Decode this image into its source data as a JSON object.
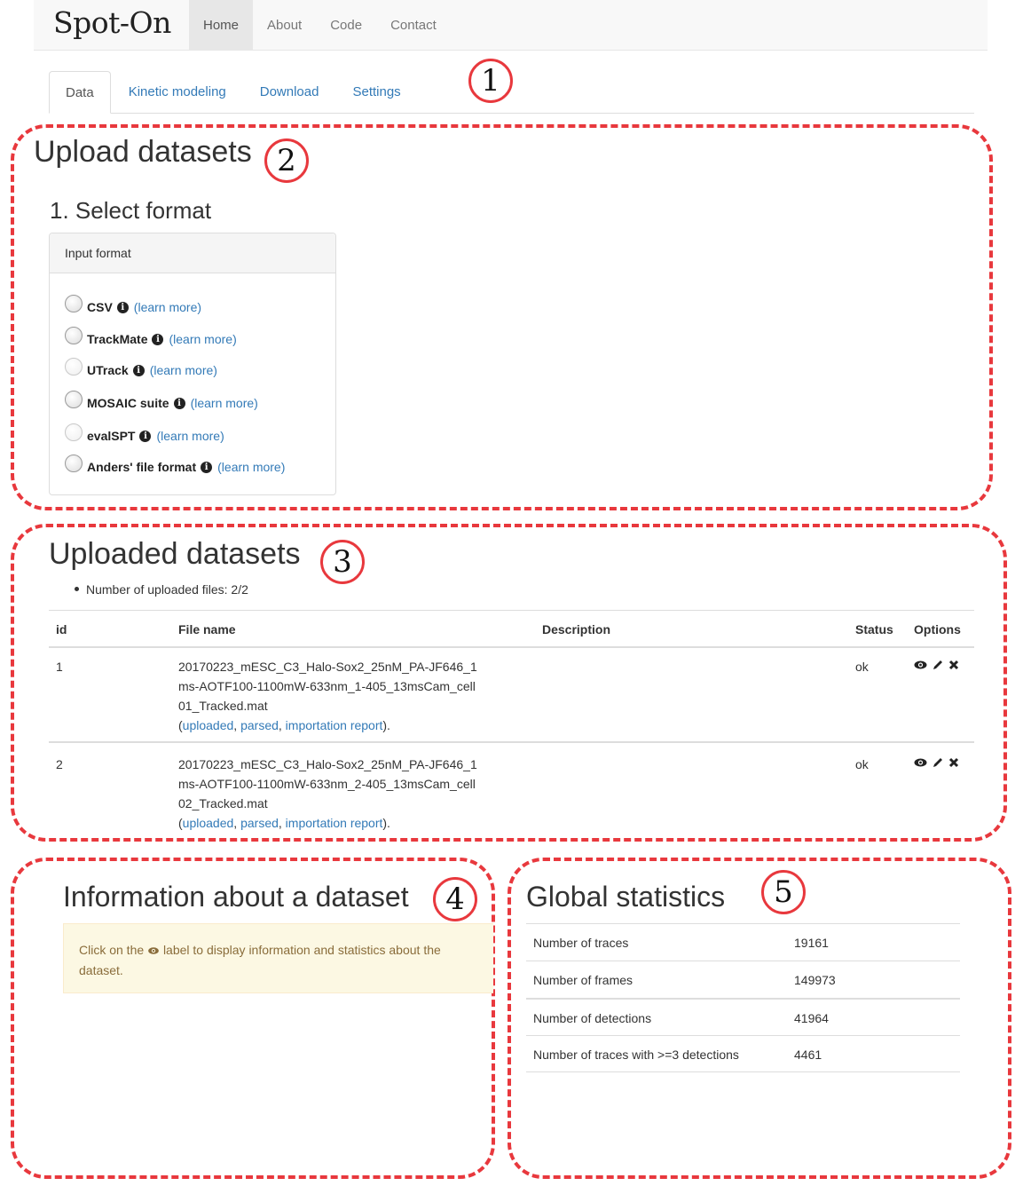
{
  "navbar": {
    "brand": "Spot-On",
    "items": [
      {
        "label": "Home",
        "active": true
      },
      {
        "label": "About",
        "active": false
      },
      {
        "label": "Code",
        "active": false
      },
      {
        "label": "Contact",
        "active": false
      }
    ]
  },
  "tabs": [
    {
      "label": "Data",
      "active": true
    },
    {
      "label": "Kinetic modeling",
      "active": false
    },
    {
      "label": "Download",
      "active": false
    },
    {
      "label": "Settings",
      "active": false
    }
  ],
  "badges": [
    "1",
    "2",
    "3",
    "4",
    "5"
  ],
  "upload": {
    "title": "Upload datasets",
    "step_title": "1. Select format",
    "panel_heading": "Input format",
    "learn_more": "(learn more)",
    "formats": [
      {
        "label": "CSV"
      },
      {
        "label": "TrackMate"
      },
      {
        "label": "UTrack"
      },
      {
        "label": "MOSAIC suite"
      },
      {
        "label": "evalSPT"
      },
      {
        "label": "Anders' file format"
      }
    ]
  },
  "uploaded": {
    "title": "Uploaded datasets",
    "count_text": "Number of uploaded files: 2/2",
    "columns": {
      "id": "id",
      "file_name": "File name",
      "description": "Description",
      "status": "Status",
      "options": "Options"
    },
    "rows": [
      {
        "id": "1",
        "file_name": "20170223_mESC_C3_Halo-Sox2_25nM_PA-JF646_1ms-AOTF100-1100mW-633nm_1-405_13msCam_cell01_Tracked.mat",
        "links": {
          "uploaded": "uploaded",
          "parsed": "parsed",
          "report": "importation report"
        },
        "description": "",
        "status": "ok"
      },
      {
        "id": "2",
        "file_name": "20170223_mESC_C3_Halo-Sox2_25nM_PA-JF646_1ms-AOTF100-1100mW-633nm_2-405_13msCam_cell02_Tracked.mat",
        "links": {
          "uploaded": "uploaded",
          "parsed": "parsed",
          "report": "importation report"
        },
        "description": "",
        "status": "ok"
      }
    ],
    "option_icons": [
      "eye-icon",
      "pencil-icon",
      "remove-icon"
    ]
  },
  "info": {
    "title": "Information about a dataset",
    "alert_before": "Click on the",
    "alert_after": "label to display information and statistics about the dataset."
  },
  "global": {
    "title": "Global statistics",
    "rows": [
      {
        "label": "Number of traces",
        "value": "19161"
      },
      {
        "label": "Number of frames",
        "value": "149973"
      },
      {
        "label": "Number of detections",
        "value": "41964"
      },
      {
        "label": "Number of traces with >=3 detections",
        "value": "4461"
      }
    ]
  },
  "colors": {
    "accent_link": "#337ab7",
    "annotation_red": "#e8383d",
    "alert_bg": "#fcf8e3"
  }
}
